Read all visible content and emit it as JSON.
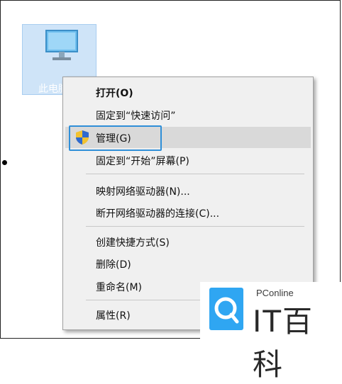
{
  "desktop": {
    "icon_label": "此电脑"
  },
  "context_menu": {
    "items": [
      {
        "label": "打开(O)"
      },
      {
        "label": "固定到“快速访问”"
      },
      {
        "label": "管理(G)"
      },
      {
        "label": "固定到“开始”屏幕(P)"
      },
      {
        "label": "映射网络驱动器(N)..."
      },
      {
        "label": "断开网络驱动器的连接(C)..."
      },
      {
        "label": "创建快捷方式(S)"
      },
      {
        "label": "删除(D)"
      },
      {
        "label": "重命名(M)"
      },
      {
        "label": "属性(R)"
      }
    ]
  },
  "watermark": {
    "small": "PConline",
    "big": "IT百科"
  },
  "colors": {
    "highlight_border": "#2f8fd8",
    "logo_blue": "#2fa6f2",
    "menu_bg": "#f0f0f0"
  }
}
